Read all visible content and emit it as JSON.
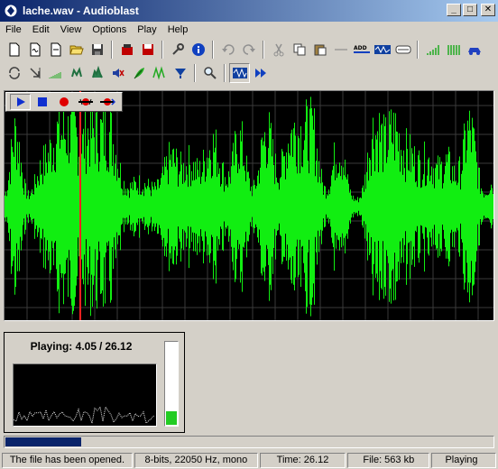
{
  "window": {
    "title": "lache.wav - Audioblast",
    "minimize_glyph": "_",
    "maximize_glyph": "□",
    "close_glyph": "✕"
  },
  "menu": [
    "File",
    "Edit",
    "View",
    "Options",
    "Play",
    "Help"
  ],
  "toolbar_top": [
    "new-icon",
    "new-silence-icon",
    "new-template-icon",
    "open-folder-icon",
    "save-icon",
    "sep",
    "record-red-icon",
    "save-red-icon",
    "sep",
    "properties-icon",
    "info-icon",
    "sep",
    "undo-icon",
    "redo-icon",
    "sep",
    "cut-icon",
    "copy-icon",
    "paste-icon",
    "paste-silence-icon",
    "add-icon",
    "mix-icon",
    "loop-icon",
    "sep",
    "ramp-icon",
    "bars-icon",
    "car-icon"
  ],
  "toolbar_bottom": [
    "reverse-icon",
    "invert-icon",
    "fade-icon",
    "echo-icon",
    "flanger-icon",
    "mute-icon",
    "feather-icon",
    "distort-icon",
    "filter-icon",
    "sep",
    "zoom-icon",
    "sep",
    "select-all-icon",
    "fast-forward-icon"
  ],
  "transport": [
    "play-icon",
    "stop-icon",
    "record-icon",
    "record-loop-icon",
    "record-append-icon"
  ],
  "colors": {
    "waveform": "#11ee11",
    "playhead": "#ff2020",
    "grid": "#3a3a3a",
    "level": "#22cc22",
    "scope_trace": "#e0e0e0"
  },
  "playback": {
    "label": "Playing:",
    "position": "4.05",
    "separator": "/",
    "length": "26.12",
    "position_fraction": 0.155,
    "level_fraction": 0.16
  },
  "status": {
    "message": "The file has been opened.",
    "format": "8-bits, 22050 Hz, mono",
    "time": "Time: 26.12",
    "file_size": "File: 563 kb",
    "state": "Playing"
  }
}
